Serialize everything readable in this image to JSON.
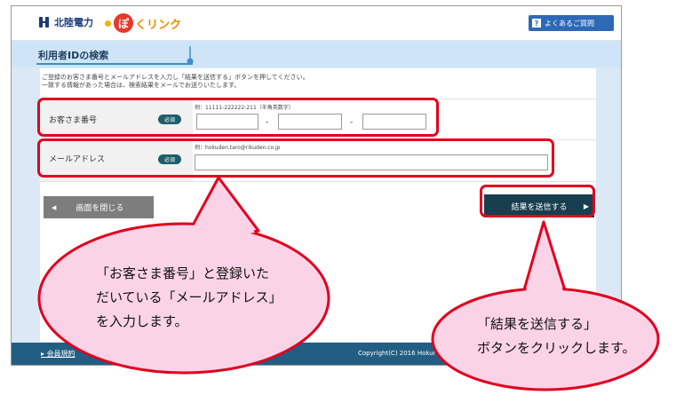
{
  "header": {
    "company_name": "北陸電力",
    "service_logo_part1": "ぽ",
    "service_logo_part2": "くリンク",
    "faq_label": "よくあるご質問"
  },
  "page": {
    "title": "利用者IDの検索",
    "instruction_line1": "ご登録のお客さま番号とメールアドレスを入力し「結果を送信する」ボタンを押してください。",
    "instruction_line2": "一致する情報があった場合は、検索結果をメールでお送りいたします。"
  },
  "form": {
    "customer_number": {
      "label": "お客さま番号",
      "required": "必須",
      "example": "例：11111-222222-211（半角英数字）",
      "separator": "-",
      "values": [
        "",
        "",
        ""
      ]
    },
    "email": {
      "label": "メールアドレス",
      "required": "必須",
      "example": "例：hokuden.taro@rikuden.co.jp",
      "value": ""
    }
  },
  "buttons": {
    "close": "画面を閉じる",
    "submit": "結果を送信する"
  },
  "footer": {
    "link": "会員規約",
    "copyright": "Copyright(C) 2016 Hokur"
  },
  "callouts": {
    "left": {
      "line1": "「お客さま番号」と登録いた",
      "line2": "だいている「メールアドレス」",
      "line3": "を入力します。"
    },
    "right": {
      "line1": "「結果を送信する」",
      "line2": "ボタンをクリックします。"
    }
  },
  "colors": {
    "highlight": "#e00020",
    "bubble_fill": "#fbd3e6",
    "submit_bg": "#173f4f",
    "footer_bg": "#225e83",
    "title_bg": "#cfe5f7"
  }
}
